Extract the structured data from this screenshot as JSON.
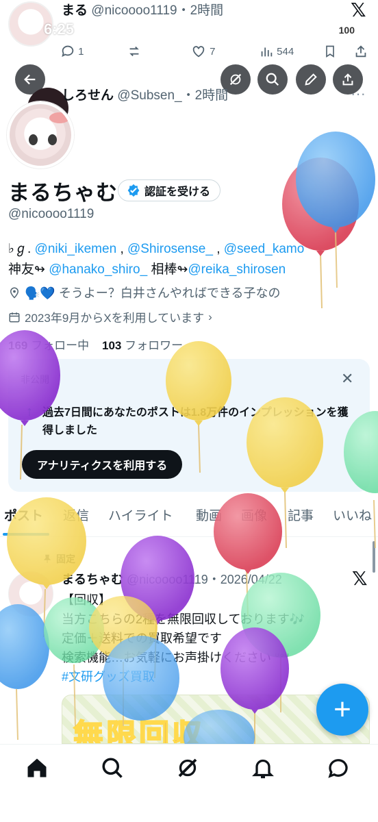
{
  "status_bar": {
    "time": "6:25",
    "battery": "100"
  },
  "ghost_post": {
    "name": "まる",
    "handle_time": "@nicoooo1119・2時間",
    "replies": "1",
    "likes": "7",
    "views": "544"
  },
  "ghost_post2": {
    "name": "しろせん",
    "handle_time": "@Subsen_・2時間"
  },
  "profile": {
    "display_name": "まるちゃむ",
    "verify_label": "認証を受ける",
    "handle": "@nicoooo1119",
    "bio_line1_prefix": "♭ℊ.",
    "bio_mention1": "@niki_ikemen",
    "bio_sep1": ",",
    "bio_mention2": "@Shirosense_",
    "bio_sep2": ",",
    "bio_mention3": "@seed_kamo",
    "bio_line2_prefix": "神友↬",
    "bio_mention4": "@hanako_shiro_",
    "bio_line2_mid": "相棒↬",
    "bio_mention5": "@reika_shirosen",
    "location": "🗣️💙 そうよー？白井さんやればできる子なの",
    "joined": "2023年9月からXを利用しています",
    "following_count": "169",
    "following_label": "フォロー中",
    "followers_count": "103",
    "followers_label": "フォロワー"
  },
  "analytics_card": {
    "private_label": "非公開",
    "text": "過去7日間にあなたのポストは1.8万件のインプレッションを獲得しました",
    "button": "アナリティクスを利用する"
  },
  "tabs": [
    "ポスト",
    "返信",
    "ハイライト",
    "動画",
    "画像",
    "記事",
    "いいね"
  ],
  "pinned_post": {
    "pinned_label": "固定",
    "name": "まるちゃむ",
    "handle_date": "@nicoooo1119・2026/04/22",
    "lines": [
      "【回収】",
      "当方こちらの2種を無限回収しております🎶",
      "定価＋送料での買取希望です",
      "検索機能…お気軽にお声掛けください ᐡᐤᐡ",
      "#文研グッズ買取"
    ],
    "image_text": "無限回収"
  },
  "colors": {
    "accent": "#1d9bf0",
    "text": "#0f1419",
    "muted": "#536471",
    "card_bg": "#eef6fc",
    "balloon_yellow": "#f2d04b",
    "balloon_purple": "#9b3fd6",
    "balloon_green": "#7ee6b0",
    "balloon_red": "#e24a5e",
    "balloon_blue": "#4aa3f0"
  },
  "icons": {
    "back": "arrow-left-icon",
    "grok": "grok-icon",
    "search": "search-icon",
    "edit": "pencil-icon",
    "share": "share-icon",
    "home": "home-icon",
    "bell": "bell-icon",
    "dm": "message-icon"
  }
}
